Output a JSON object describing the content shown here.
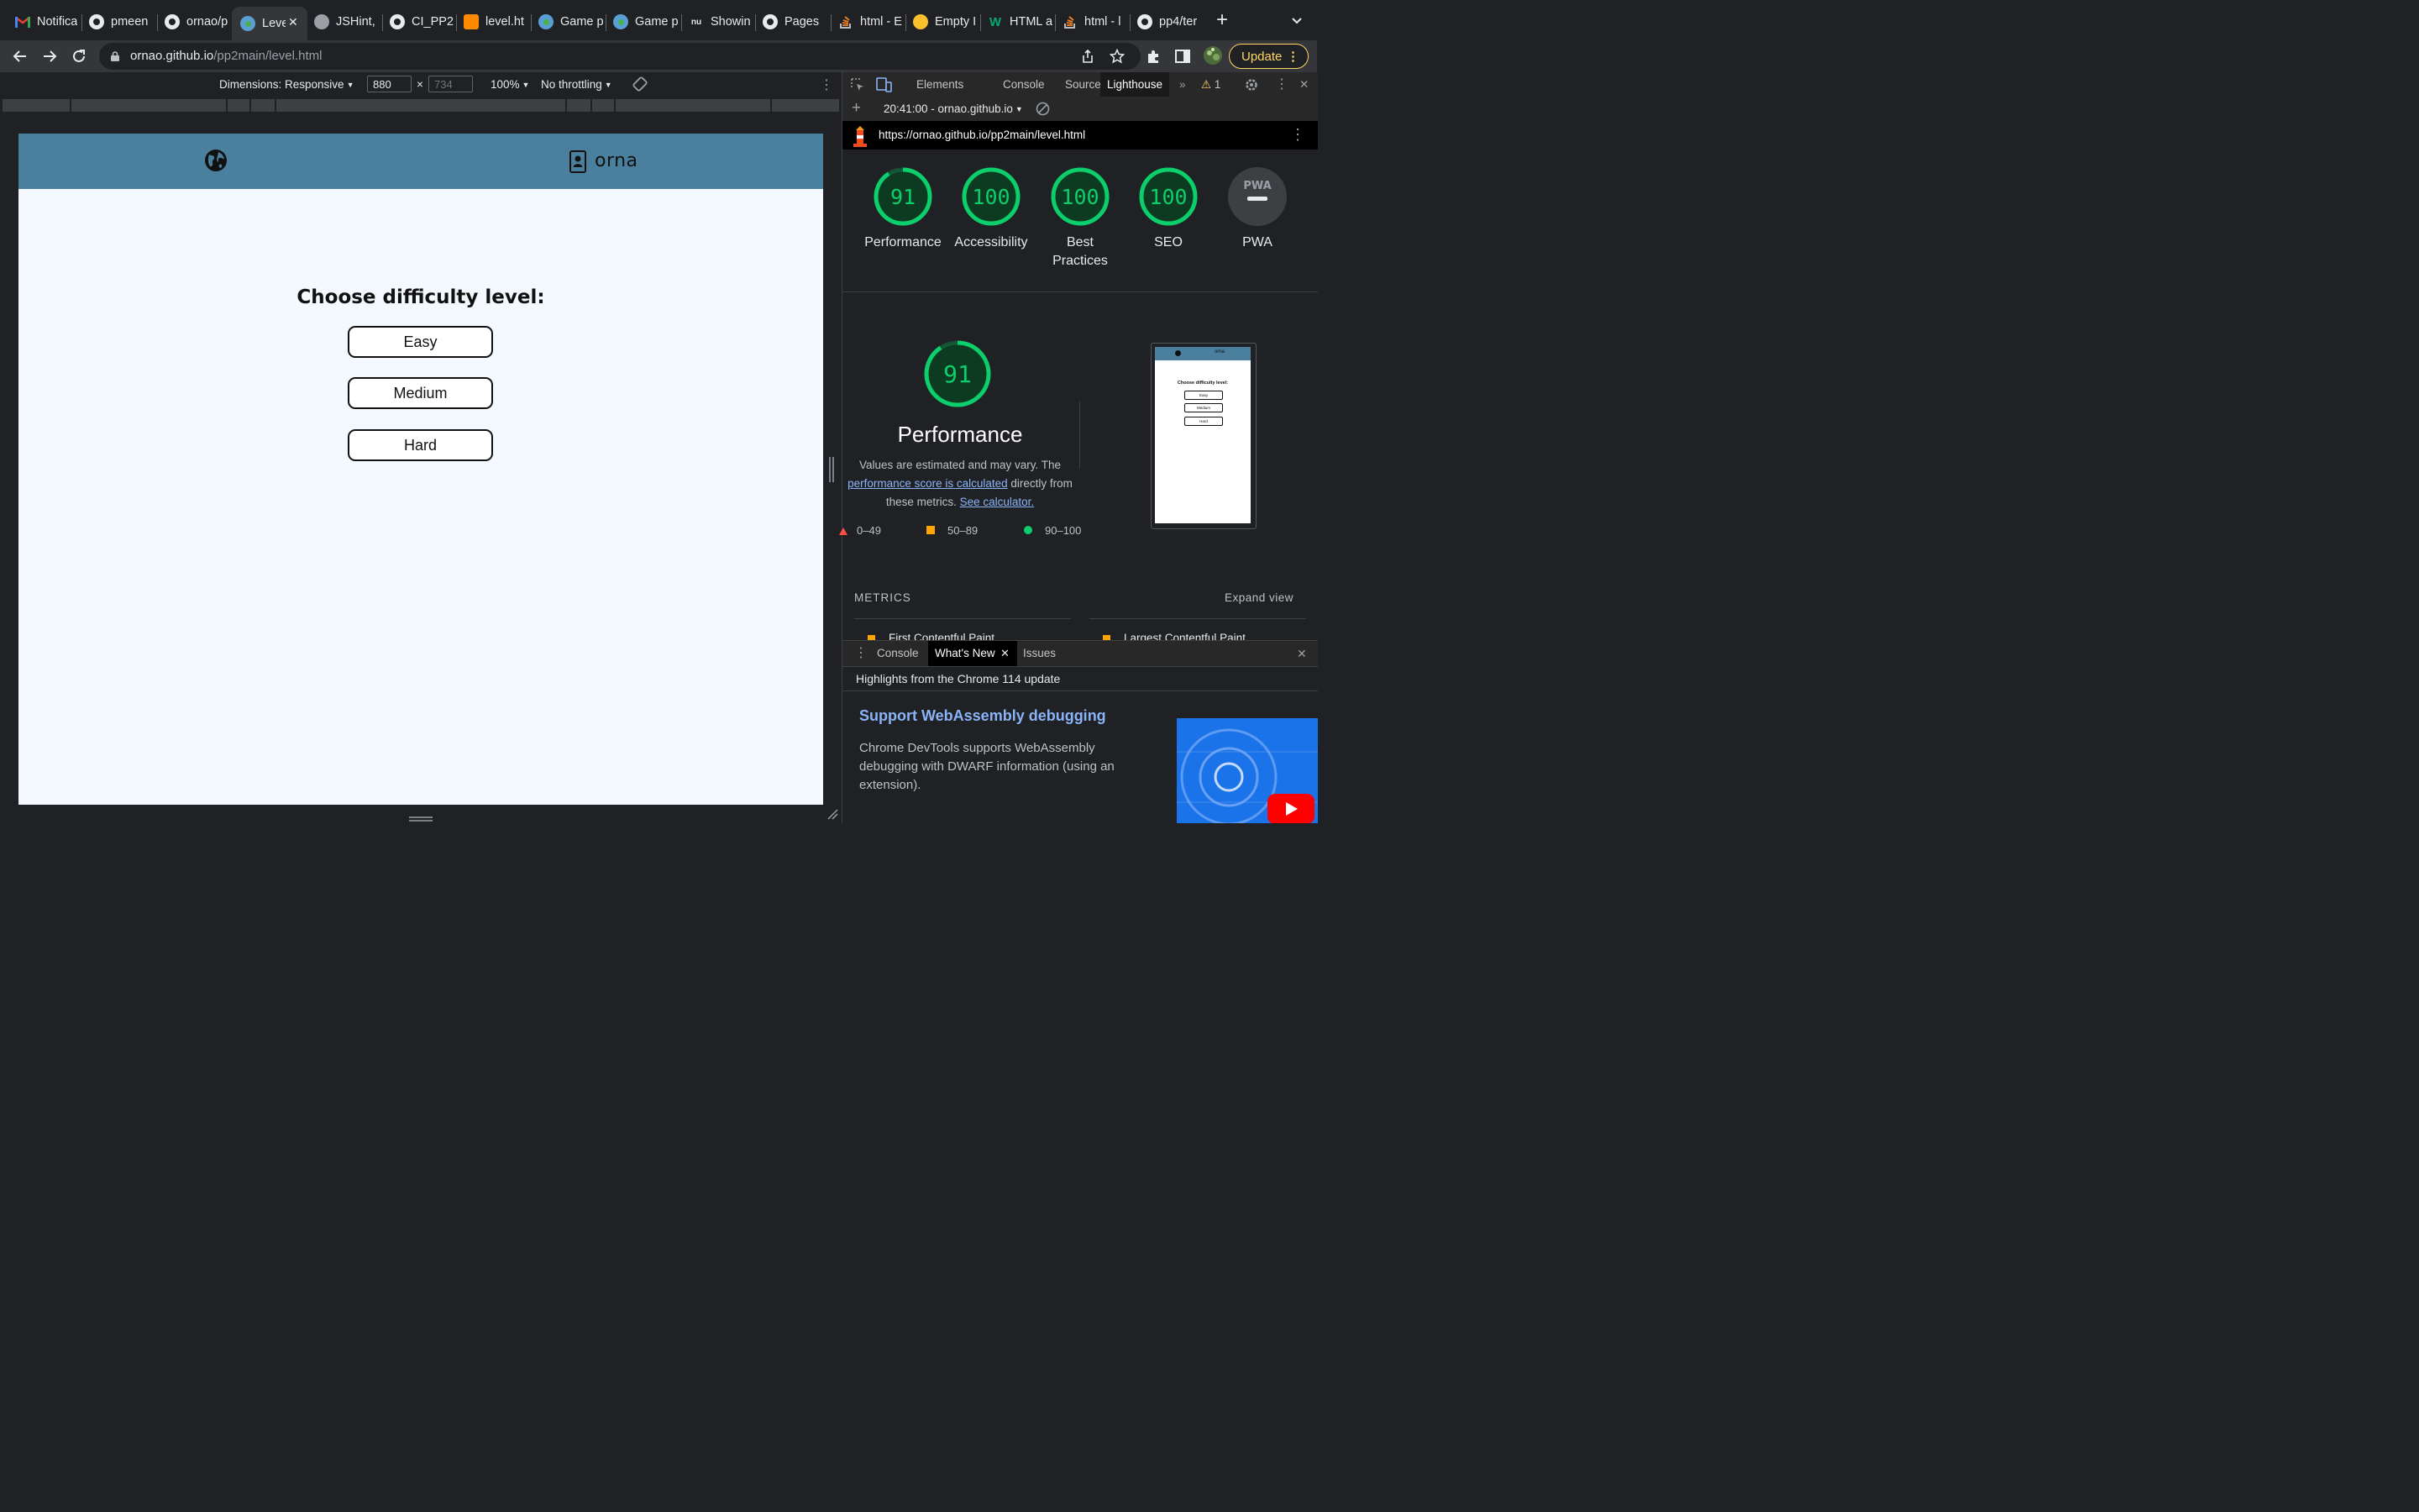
{
  "browser": {
    "tabs": [
      {
        "title": "Notifica",
        "icon": "gmail-icon"
      },
      {
        "title": "pmeen",
        "icon": "github-icon"
      },
      {
        "title": "ornao/p",
        "icon": "github-icon"
      },
      {
        "title": "Leve",
        "icon": "globe-icon",
        "active": true
      },
      {
        "title": "JSHint,",
        "icon": "globe-icon"
      },
      {
        "title": "CI_PP2",
        "icon": "github-icon"
      },
      {
        "title": "level.ht",
        "icon": "gitpod-icon"
      },
      {
        "title": "Game p",
        "icon": "globe-icon"
      },
      {
        "title": "Game p",
        "icon": "globe-icon"
      },
      {
        "title": "Showin",
        "icon": "nu-icon"
      },
      {
        "title": "Pages",
        "icon": "github-icon"
      },
      {
        "title": "html - E",
        "icon": "stackoverflow-icon"
      },
      {
        "title": "Empty I",
        "icon": "emoji-icon"
      },
      {
        "title": "HTML a",
        "icon": "w3schools-icon"
      },
      {
        "title": "html - l",
        "icon": "stackoverflow-icon"
      },
      {
        "title": "pp4/ter",
        "icon": "github-icon"
      }
    ],
    "url_host": "ornao.github.io",
    "url_path": "/pp2main/level.html",
    "update_label": "Update"
  },
  "device_toolbar": {
    "dimensions": "Dimensions: Responsive",
    "width": "880",
    "height_placeholder": "734",
    "times": "×",
    "zoom": "100%",
    "throttling": "No throttling"
  },
  "site": {
    "brand": "orna",
    "heading": "Choose difficulty level:",
    "levels": [
      "Easy",
      "Medium",
      "Hard"
    ],
    "header_color": "#4a7f9e"
  },
  "devtools": {
    "tabs": [
      "Elements",
      "Console",
      "Sources",
      "Lighthouse"
    ],
    "active_tab": "Lighthouse",
    "warning_count": "1",
    "report_label": "20:41:00 - ornao.github.io",
    "report_url": "https://ornao.github.io/pp2main/level.html",
    "scores": [
      {
        "value": 91,
        "label": "Performance"
      },
      {
        "value": 100,
        "label": "Accessibility"
      },
      {
        "value": 100,
        "label": "Best Practices"
      },
      {
        "value": 100,
        "label": "SEO"
      },
      {
        "value": null,
        "label": "PWA"
      }
    ],
    "pwa_badge": "PWA",
    "performance": {
      "score": "91",
      "title": "Performance",
      "desc_before": "Values are estimated and may vary. The ",
      "desc_link": "performance score is calculated",
      "desc_middle": " directly from these metrics. ",
      "desc_link2": "See calculator.",
      "legend": [
        "0–49",
        "50–89",
        "90–100"
      ]
    },
    "thumb": {
      "heading": "Choose difficulty level:",
      "levels": [
        "Easy",
        "Medium",
        "Hard"
      ],
      "brand": "orna"
    },
    "metrics_heading": "METRICS",
    "expand_label": "Expand view",
    "metrics": [
      "First Contentful Paint",
      "Largest Contentful Paint"
    ],
    "score_color": "#0cce6b",
    "drawer": {
      "tabs": [
        "Console",
        "What's New",
        "Issues"
      ],
      "active": "What's New",
      "highlights": "Highlights from the Chrome 114 update",
      "news_title": "Support WebAssembly debugging",
      "news_body": "Chrome DevTools supports WebAssembly debugging with DWARF information (using an extension)."
    }
  }
}
